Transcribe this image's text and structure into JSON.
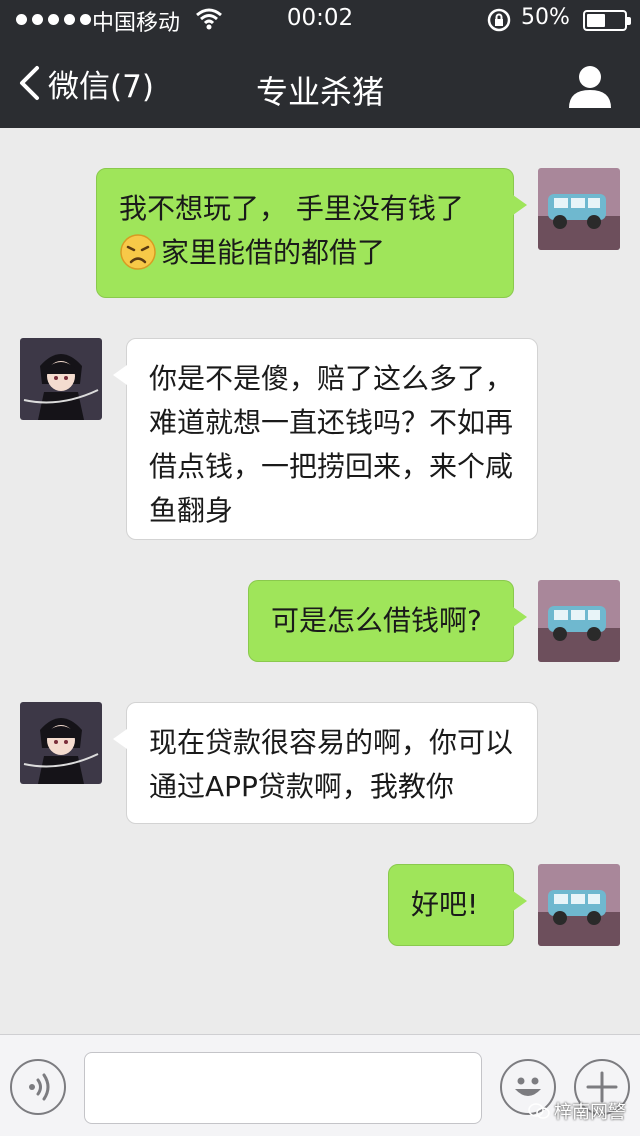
{
  "status_bar": {
    "carrier": "中国移动",
    "time": "00:02",
    "battery_percent": "50%",
    "battery_level": 0.5
  },
  "nav": {
    "back_label": "微信(7)",
    "title": "专业杀猪"
  },
  "messages": [
    {
      "direction": "out",
      "lines": [
        "我不想玩了， 手里没有钱了",
        "家里能借的都借了"
      ],
      "emoji_on_line": 1,
      "emoji": "disappointed-face-icon"
    },
    {
      "direction": "in",
      "lines": [
        "你是不是傻，赔了这么多了，",
        "难道就想一直还钱吗？不如再",
        "借点钱，一把捞回来，来个咸",
        "鱼翻身"
      ]
    },
    {
      "direction": "out",
      "lines": [
        "可是怎么借钱啊?"
      ]
    },
    {
      "direction": "in",
      "lines": [
        "现在贷款很容易的啊，你可以",
        "通过APP贷款啊，我教你"
      ]
    },
    {
      "direction": "out",
      "lines": [
        "好吧!"
      ]
    }
  ],
  "watermark": "梓南网警",
  "colors": {
    "nav_background": "#2b2d31",
    "chat_background": "#ebebeb",
    "outgoing_bubble": "#9fe55a",
    "incoming_bubble": "#ffffff"
  }
}
